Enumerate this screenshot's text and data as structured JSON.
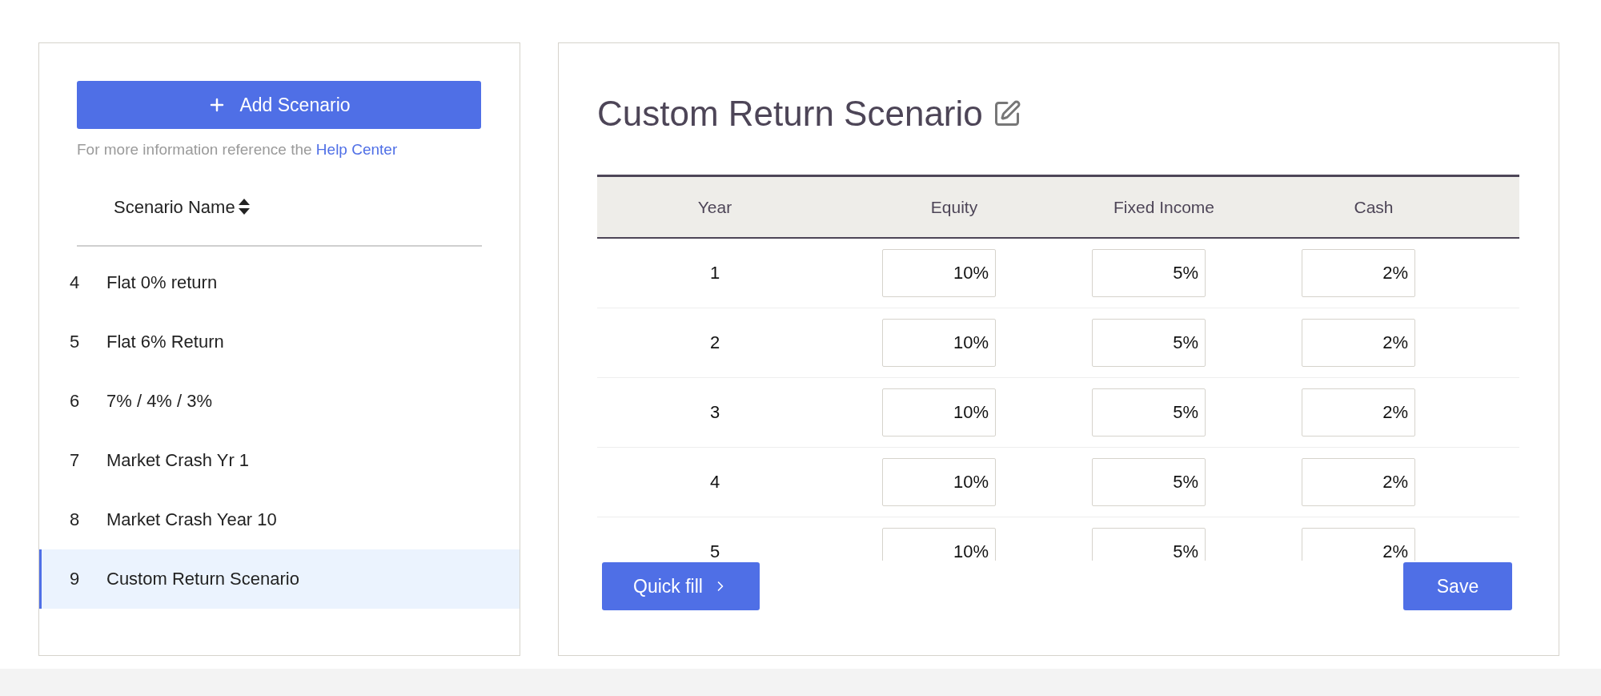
{
  "sidebar": {
    "add_button": "Add Scenario",
    "help_text": "For more information reference the",
    "help_link": "Help Center",
    "column_header": "Scenario Name",
    "items": [
      {
        "number": "4",
        "name": "Flat 0% return",
        "selected": false
      },
      {
        "number": "5",
        "name": "Flat 6% Return",
        "selected": false
      },
      {
        "number": "6",
        "name": "7% / 4% / 3%",
        "selected": false
      },
      {
        "number": "7",
        "name": "Market Crash Yr 1",
        "selected": false
      },
      {
        "number": "8",
        "name": "Market Crash Year 10",
        "selected": false
      },
      {
        "number": "9",
        "name": "Custom Return Scenario",
        "selected": true
      }
    ]
  },
  "editor": {
    "title": "Custom Return Scenario",
    "table": {
      "columns": [
        "Year",
        "Equity",
        "Fixed Income",
        "Cash"
      ],
      "rows": [
        {
          "year": "1",
          "equity": "10%",
          "fixed_income": "5%",
          "cash": "2%"
        },
        {
          "year": "2",
          "equity": "10%",
          "fixed_income": "5%",
          "cash": "2%"
        },
        {
          "year": "3",
          "equity": "10%",
          "fixed_income": "5%",
          "cash": "2%"
        },
        {
          "year": "4",
          "equity": "10%",
          "fixed_income": "5%",
          "cash": "2%"
        },
        {
          "year": "5",
          "equity": "10%",
          "fixed_income": "5%",
          "cash": "2%"
        }
      ]
    },
    "quick_fill_button": "Quick fill",
    "save_button": "Save"
  }
}
